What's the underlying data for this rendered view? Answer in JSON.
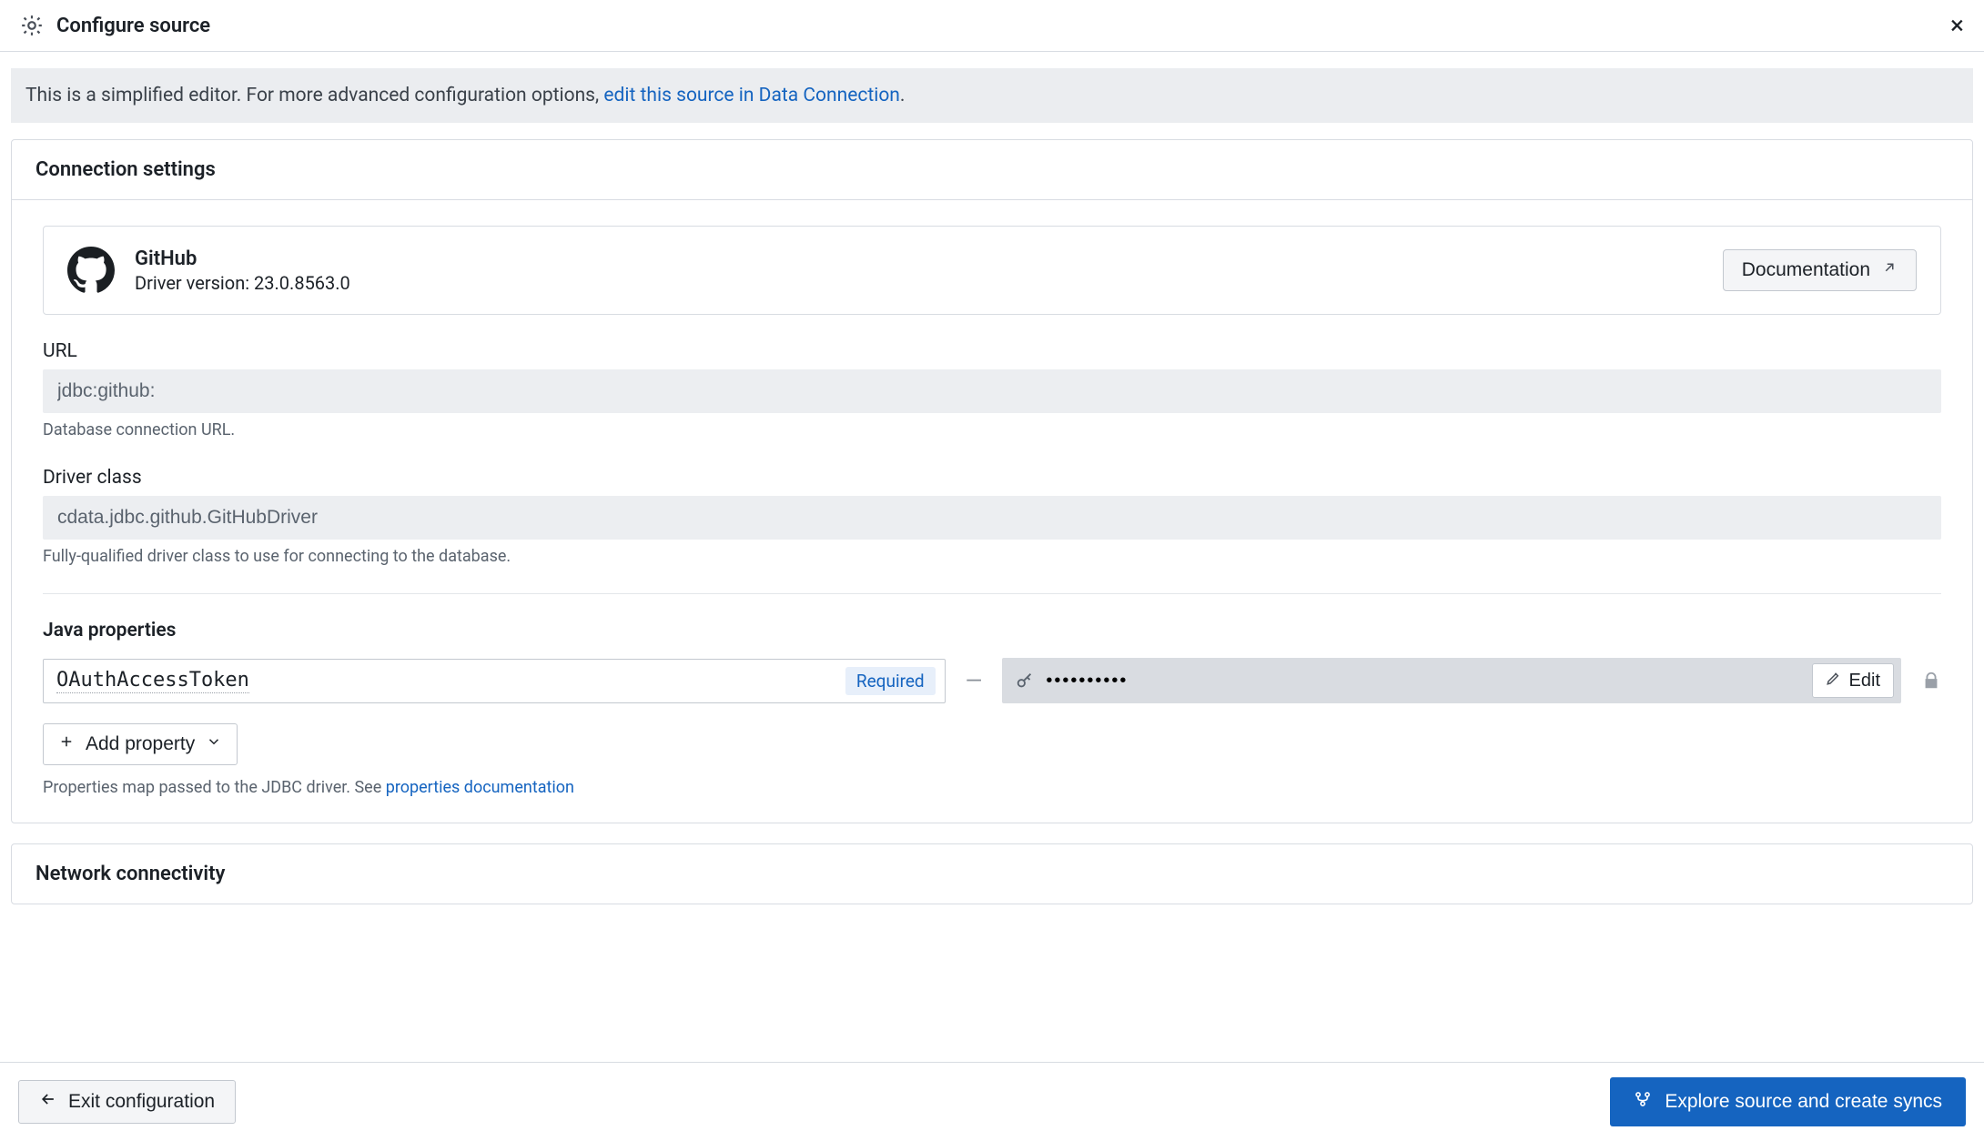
{
  "header": {
    "title": "Configure source"
  },
  "banner": {
    "prefix": "This is a simplified editor. For more advanced configuration options, ",
    "link_text": "edit this source in Data Connection",
    "suffix": "."
  },
  "sections": {
    "connection": {
      "title": "Connection settings"
    },
    "network": {
      "title": "Network connectivity"
    }
  },
  "source": {
    "name": "GitHub",
    "driver_version_label": "Driver version: 23.0.8563.0",
    "documentation_label": "Documentation"
  },
  "fields": {
    "url": {
      "label": "URL",
      "value": "jdbc:github:",
      "help": "Database connection URL."
    },
    "driver_class": {
      "label": "Driver class",
      "value": "cdata.jdbc.github.GitHubDriver",
      "help": "Fully-qualified driver class to use for connecting to the database."
    }
  },
  "java_properties": {
    "title": "Java properties",
    "rows": [
      {
        "key": "OAuthAccessToken",
        "required_label": "Required",
        "value_mask": "••••••••••",
        "edit_label": "Edit"
      }
    ],
    "add_label": "Add property",
    "help_prefix": "Properties map passed to the JDBC driver. See ",
    "help_link": "properties documentation"
  },
  "footer": {
    "exit_label": "Exit configuration",
    "primary_label": "Explore source and create syncs"
  }
}
